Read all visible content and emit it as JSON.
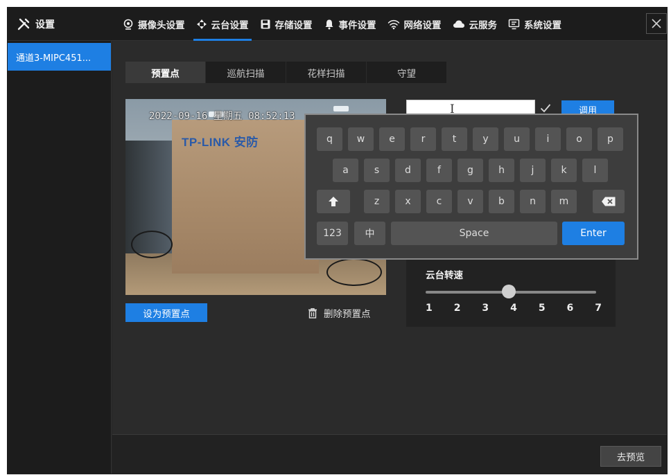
{
  "header": {
    "title": "设置",
    "nav": [
      {
        "label": "摄像头设置",
        "icon": "camera-icon"
      },
      {
        "label": "云台设置",
        "icon": "ptz-icon"
      },
      {
        "label": "存储设置",
        "icon": "save-icon"
      },
      {
        "label": "事件设置",
        "icon": "bell-icon"
      },
      {
        "label": "网络设置",
        "icon": "wifi-icon"
      },
      {
        "label": "云服务",
        "icon": "cloud-icon"
      },
      {
        "label": "系统设置",
        "icon": "monitor-icon"
      }
    ],
    "active_nav": "云台设置"
  },
  "sidebar": {
    "channel": "通道3-MIPC451..."
  },
  "subtabs": [
    {
      "label": "预置点"
    },
    {
      "label": "巡航扫描"
    },
    {
      "label": "花样扫描"
    },
    {
      "label": "守望"
    }
  ],
  "video": {
    "osd": "2022-09-16 星期五 08:52:13",
    "box_logo": "TP-LINK 安防"
  },
  "preset": {
    "set_label": "设为预置点",
    "delete_label": "删除预置点",
    "input_value": "",
    "call_label": "调用"
  },
  "ptz_speed": {
    "label": "云台转速",
    "ticks": [
      "1",
      "2",
      "3",
      "4",
      "5",
      "6",
      "7"
    ],
    "value": 4
  },
  "keyboard": {
    "row1": [
      "q",
      "w",
      "e",
      "r",
      "t",
      "y",
      "u",
      "i",
      "o",
      "p"
    ],
    "row2": [
      "a",
      "s",
      "d",
      "f",
      "g",
      "h",
      "j",
      "k",
      "l"
    ],
    "row3": [
      "z",
      "x",
      "c",
      "v",
      "b",
      "n",
      "m"
    ],
    "num_label": "123",
    "lang_label": "中",
    "space_label": "Space",
    "enter_label": "Enter"
  },
  "footer": {
    "preview_label": "去预览"
  },
  "colors": {
    "accent": "#1e7fe3",
    "background": "#252525",
    "panel": "#2b2b2b"
  }
}
